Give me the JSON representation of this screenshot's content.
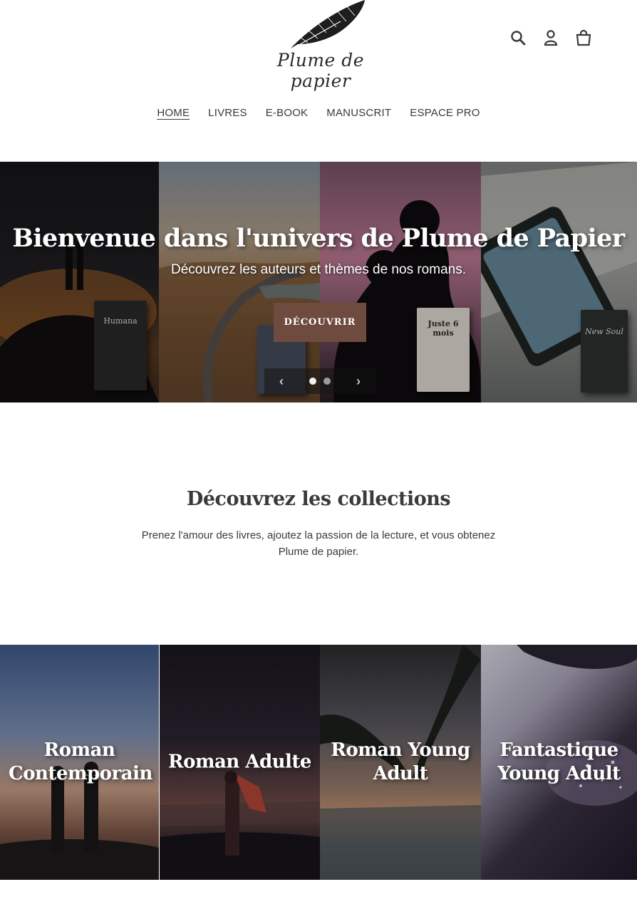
{
  "header": {
    "logo_text": "Plume de papier",
    "icons": [
      "search-icon",
      "account-icon",
      "cart-icon"
    ]
  },
  "nav": {
    "items": [
      {
        "label": "HOME",
        "active": true
      },
      {
        "label": "LIVRES",
        "active": false
      },
      {
        "label": "E-BOOK",
        "active": false
      },
      {
        "label": "MANUSCRIT",
        "active": false
      },
      {
        "label": "ESPACE PRO",
        "active": false
      }
    ]
  },
  "hero": {
    "title": "Bienvenue dans l'univers de Plume de Papier",
    "subtitle": "Découvrez les auteurs et thèmes de nos romans.",
    "button_label": "DÉCOUVRIR",
    "books": [
      "Humana",
      "Juste 6 mois",
      "New Soul"
    ],
    "slide_count": 2,
    "active_slide": 1
  },
  "collections": {
    "title": "Découvrez les collections",
    "description": "Prenez l'amour des livres, ajoutez la passion de la lecture, et vous obtenez Plume de papier.",
    "items": [
      {
        "label": "Roman Contemporain"
      },
      {
        "label": "Roman Adulte"
      },
      {
        "label": "Roman Young Adult"
      },
      {
        "label": "Fantastique Young Adult"
      }
    ]
  },
  "colors": {
    "button_bg": "#6f4a3f",
    "text": "#3a3a3a"
  }
}
